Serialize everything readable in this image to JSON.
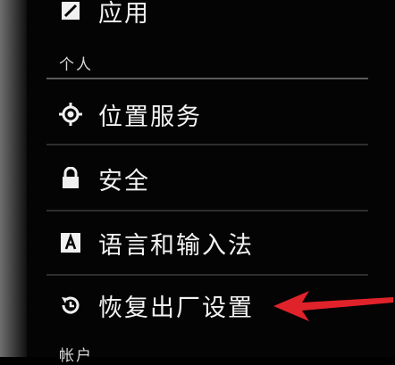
{
  "settings": {
    "items": [
      {
        "label": "应用",
        "icon": "apps-icon"
      },
      {
        "label": "位置服务",
        "icon": "location-icon"
      },
      {
        "label": "安全",
        "icon": "lock-icon"
      },
      {
        "label": "语言和输入法",
        "icon": "keyboard-a-icon"
      },
      {
        "label": "恢复出厂设置",
        "icon": "restore-icon"
      }
    ],
    "sections": {
      "personal": "个人",
      "accounts": "帐户"
    }
  },
  "annotation": {
    "arrow_color": "#e0222a"
  },
  "colors": {
    "background": "#040404",
    "text": "#f3f3f3",
    "divider": "#2d2d2d"
  }
}
